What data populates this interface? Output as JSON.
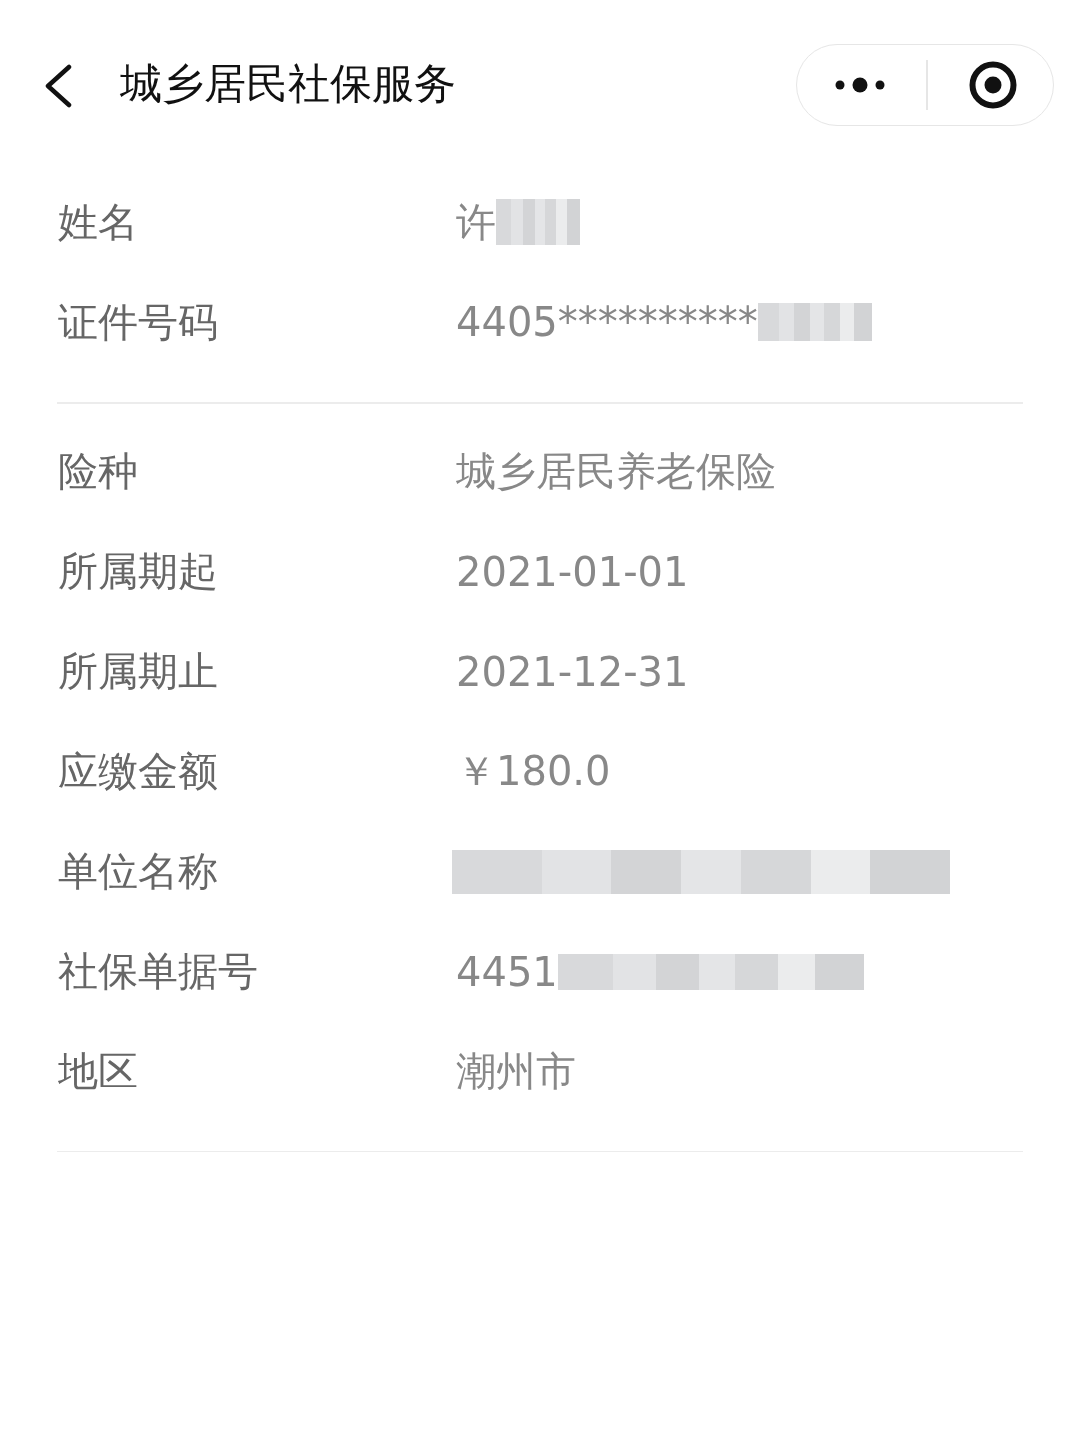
{
  "header": {
    "title": "城乡居民社保服务"
  },
  "sections": [
    {
      "rows": [
        {
          "label": "姓名",
          "value": "许",
          "redacted": true
        },
        {
          "label": "证件号码",
          "value": "4405**********",
          "redacted": true
        }
      ]
    },
    {
      "rows": [
        {
          "label": "险种",
          "value": "城乡居民养老保险",
          "redacted": false
        },
        {
          "label": "所属期起",
          "value": "2021-01-01",
          "redacted": false
        },
        {
          "label": "所属期止",
          "value": "2021-12-31",
          "redacted": false
        },
        {
          "label": "应缴金额",
          "value": "￥180.0",
          "redacted": false
        },
        {
          "label": "单位名称",
          "redacted": true
        },
        {
          "label": "社保单据号",
          "value": "4451",
          "redacted": true
        },
        {
          "label": "地区",
          "value": "潮州市",
          "redacted": false
        }
      ]
    }
  ]
}
